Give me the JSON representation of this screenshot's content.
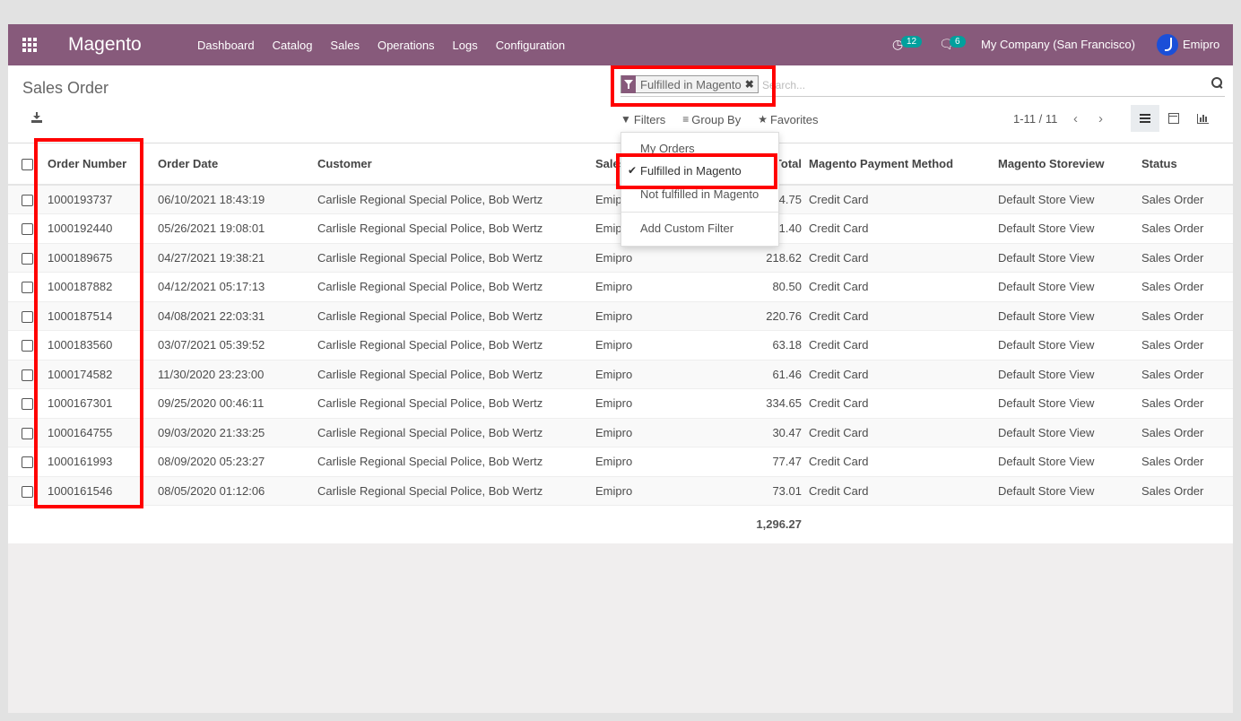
{
  "navbar": {
    "brand": "Magento",
    "menu": [
      "Dashboard",
      "Catalog",
      "Sales",
      "Operations",
      "Logs",
      "Configuration"
    ],
    "activities_count": "12",
    "messages_count": "6",
    "company": "My Company (San Francisco)",
    "user": "Emipro",
    "brand_color": "#875a7b"
  },
  "control_panel": {
    "title": "Sales Order",
    "facet_label": "Fulfilled in Magento",
    "search_placeholder": "Search...",
    "filters_label": "Filters",
    "group_by_label": "Group By",
    "favorites_label": "Favorites",
    "pager_text": "1-11 / 11"
  },
  "filters_dropdown": {
    "items": [
      {
        "label": "My Orders",
        "selected": false
      },
      {
        "label": "Fulfilled in Magento",
        "selected": true
      },
      {
        "label": "Not fulfilled in Magento",
        "selected": false
      }
    ],
    "custom_filter": "Add Custom Filter"
  },
  "table": {
    "columns": [
      "Order Number",
      "Order Date",
      "Customer",
      "Salesperson",
      "Total",
      "Magento Payment Method",
      "Magento Storeview",
      "Status"
    ],
    "rows": [
      {
        "order": "1000193737",
        "date": "06/10/2021 18:43:19",
        "customer": "Carlisle Regional Special Police, Bob Wertz",
        "sales": "Emipro",
        "total": "74.75",
        "payment": "Credit Card",
        "store": "Default Store View",
        "status": "Sales Order"
      },
      {
        "order": "1000192440",
        "date": "05/26/2021 19:08:01",
        "customer": "Carlisle Regional Special Police, Bob Wertz",
        "sales": "Emipro",
        "total": "71.40",
        "payment": "Credit Card",
        "store": "Default Store View",
        "status": "Sales Order"
      },
      {
        "order": "1000189675",
        "date": "04/27/2021 19:38:21",
        "customer": "Carlisle Regional Special Police, Bob Wertz",
        "sales": "Emipro",
        "total": "218.62",
        "payment": "Credit Card",
        "store": "Default Store View",
        "status": "Sales Order"
      },
      {
        "order": "1000187882",
        "date": "04/12/2021 05:17:13",
        "customer": "Carlisle Regional Special Police, Bob Wertz",
        "sales": "Emipro",
        "total": "80.50",
        "payment": "Credit Card",
        "store": "Default Store View",
        "status": "Sales Order"
      },
      {
        "order": "1000187514",
        "date": "04/08/2021 22:03:31",
        "customer": "Carlisle Regional Special Police, Bob Wertz",
        "sales": "Emipro",
        "total": "220.76",
        "payment": "Credit Card",
        "store": "Default Store View",
        "status": "Sales Order"
      },
      {
        "order": "1000183560",
        "date": "03/07/2021 05:39:52",
        "customer": "Carlisle Regional Special Police, Bob Wertz",
        "sales": "Emipro",
        "total": "63.18",
        "payment": "Credit Card",
        "store": "Default Store View",
        "status": "Sales Order"
      },
      {
        "order": "1000174582",
        "date": "11/30/2020 23:23:00",
        "customer": "Carlisle Regional Special Police, Bob Wertz",
        "sales": "Emipro",
        "total": "61.46",
        "payment": "Credit Card",
        "store": "Default Store View",
        "status": "Sales Order"
      },
      {
        "order": "1000167301",
        "date": "09/25/2020 00:46:11",
        "customer": "Carlisle Regional Special Police, Bob Wertz",
        "sales": "Emipro",
        "total": "334.65",
        "payment": "Credit Card",
        "store": "Default Store View",
        "status": "Sales Order"
      },
      {
        "order": "1000164755",
        "date": "09/03/2020 21:33:25",
        "customer": "Carlisle Regional Special Police, Bob Wertz",
        "sales": "Emipro",
        "total": "30.47",
        "payment": "Credit Card",
        "store": "Default Store View",
        "status": "Sales Order"
      },
      {
        "order": "1000161993",
        "date": "08/09/2020 05:23:27",
        "customer": "Carlisle Regional Special Police, Bob Wertz",
        "sales": "Emipro",
        "total": "77.47",
        "payment": "Credit Card",
        "store": "Default Store View",
        "status": "Sales Order"
      },
      {
        "order": "1000161546",
        "date": "08/05/2020 01:12:06",
        "customer": "Carlisle Regional Special Police, Bob Wertz",
        "sales": "Emipro",
        "total": "73.01",
        "payment": "Credit Card",
        "store": "Default Store View",
        "status": "Sales Order"
      }
    ],
    "total_sum": "1,296.27"
  },
  "highlight_color": "#ff0000"
}
